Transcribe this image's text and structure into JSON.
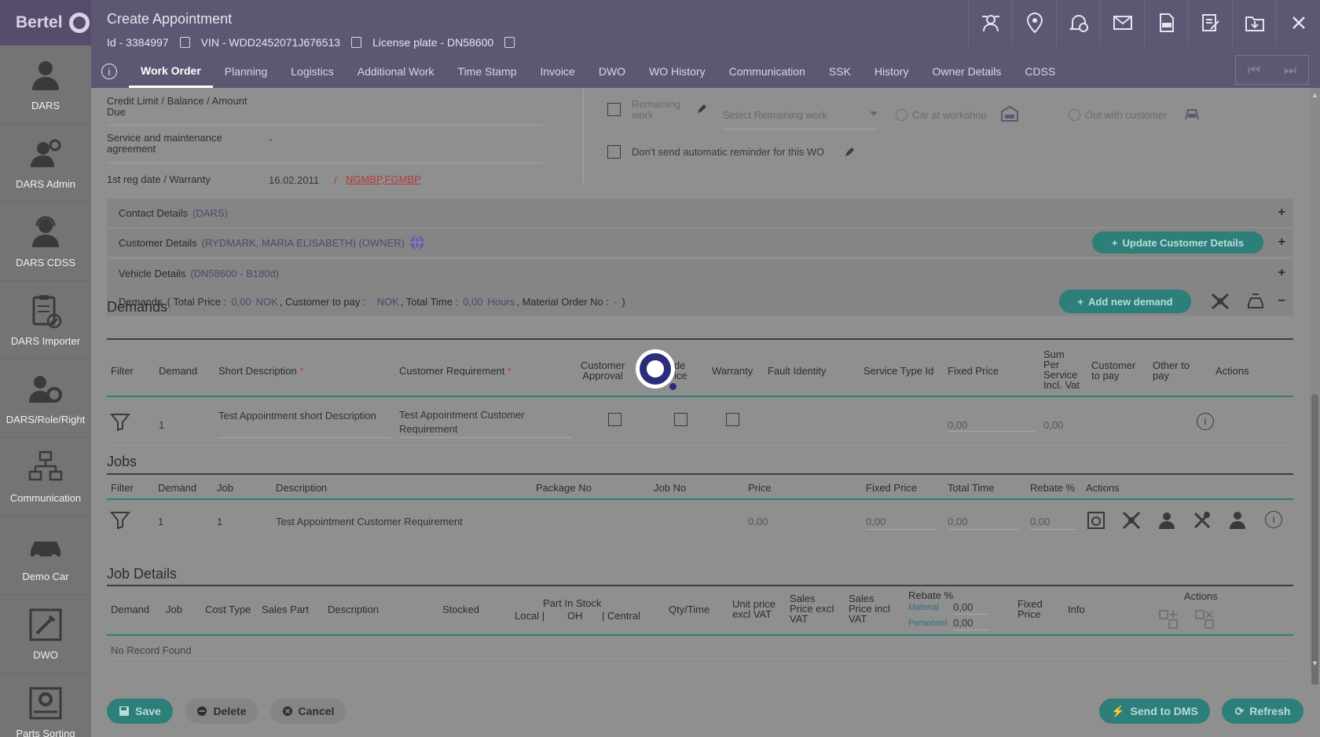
{
  "app": {
    "name": "Bertel"
  },
  "sidebar": {
    "items": [
      {
        "label": "DARS",
        "icon": "user-icon"
      },
      {
        "label": "DARS Admin",
        "icon": "user-gear-icon"
      },
      {
        "label": "DARS CDSS",
        "icon": "headset-user-icon"
      },
      {
        "label": "DARS Importer",
        "icon": "clipboard-check-icon"
      },
      {
        "label": "DARS/Role/Right",
        "icon": "users-gear-icon"
      },
      {
        "label": "Communication",
        "icon": "network-icon"
      },
      {
        "label": "Demo Car",
        "icon": "car-icon"
      },
      {
        "label": "DWO",
        "icon": "tools-icon"
      },
      {
        "label": "Parts Sorting",
        "icon": "settings-box-icon"
      }
    ]
  },
  "header": {
    "title": "Create Appointment",
    "id_text": "Id - 3384997",
    "vin_text": "VIN - WDD2452071J676513",
    "plate_text": "License plate - DN58600",
    "tabs": [
      "Work Order",
      "Planning",
      "Logistics",
      "Additional Work",
      "Time Stamp",
      "Invoice",
      "DWO",
      "WO History",
      "Communication",
      "SSK",
      "History",
      "Owner Details",
      "CDSS"
    ],
    "active_tab": "Work Order",
    "icons": [
      "transfer-user-icon",
      "map-pin-icon",
      "bell-clock-icon",
      "mail-icon",
      "pdf-icon",
      "edit-doc-icon",
      "folder-download-icon",
      "close-icon"
    ]
  },
  "info": {
    "credit_label": "Credit Limit / Balance / Amount Due",
    "service_label": "Service and maintenance agreement",
    "service_value": "-",
    "reg_label": "1st reg date / Warranty",
    "reg_date": "16.02.2011",
    "reg_sep": "/",
    "warranty_link": "NGMBP,FGMBP",
    "remaining_work_label": "Remaining work",
    "remaining_select_placeholder": "Select Remaining work",
    "car_at_workshop": "Car at workshop",
    "out_with_customer": "Out with customer",
    "no_reminder_label": "Don't send automatic reminder for this WO"
  },
  "accordions": {
    "contact": {
      "label": "Contact Details",
      "sub": "(DARS)"
    },
    "customer": {
      "label": "Customer Details",
      "sub": "(RYDMARK, MARIA ELISABETH) (OWNER)",
      "button": "Update Customer Details"
    },
    "vehicle": {
      "label": "Vehicle Details",
      "sub": "(DN58600 - B180d)"
    },
    "demands": {
      "label": "Demands",
      "p1": "( Total Price :",
      "total_price": "0,00",
      "currency": "NOK",
      "p2": ", Customer to pay :",
      "currency2": "NOK",
      "p3": ", Total Time :",
      "total_time": "0,00",
      "hours": "Hours",
      "p4": ", Material Order No :",
      "material_no": "-",
      "p5": ")",
      "button": "Add new demand"
    }
  },
  "demands": {
    "title": "Demands",
    "headers": {
      "filter": "Filter",
      "demand": "Demand",
      "short_desc": "Short Description",
      "cust_req": "Customer Requirement",
      "cust_approval": "Customer Approval",
      "goodwill_frag": "de\nice",
      "warranty": "Warranty",
      "fault": "Fault Identity",
      "service_type": "Service Type Id",
      "fixed_price": "Fixed Price",
      "sum_per_service": "Sum Per Service Incl. Vat",
      "customer_to_pay": "Customer to pay",
      "other_to_pay": "Other to pay",
      "actions": "Actions"
    },
    "required_mark": "*",
    "row": {
      "demand": "1",
      "short_desc": "Test Appointment short Description",
      "cust_req": "Test Appointment Customer Requirement",
      "fixed_price": "0,00",
      "sum": "0,00"
    }
  },
  "jobs": {
    "title": "Jobs",
    "headers": {
      "filter": "Filter",
      "demand": "Demand",
      "job": "Job",
      "description": "Description",
      "package_no": "Package No",
      "job_no": "Job No",
      "price": "Price",
      "fixed_price": "Fixed Price",
      "total_time": "Total Time",
      "rebate": "Rebate %",
      "actions": "Actions"
    },
    "row": {
      "demand": "1",
      "job": "1",
      "description": "Test Appointment Customer Requirement",
      "price": "0,00",
      "fixed_price": "0,00",
      "total_time": "0,00",
      "rebate": "0,00"
    }
  },
  "job_details": {
    "title": "Job Details",
    "headers": {
      "demand": "Demand",
      "job": "Job",
      "cost_type": "Cost Type",
      "sales_part": "Sales Part",
      "description": "Description",
      "stocked": "Stocked",
      "part_in_stock": "Part In Stock",
      "local": "Local |",
      "oh": "OH",
      "central": "| Central",
      "qty_time": "Qty/Time",
      "unit_price": "Unit price excl VAT",
      "sales_excl": "Sales Price excl VAT",
      "sales_incl": "Sales Price incl VAT",
      "rebate": "Rebate %",
      "material": "Material",
      "material_val": "0,00",
      "personnel": "Personnel",
      "personnel_val": "0,00",
      "fixed_price": "Fixed Price",
      "info": "Info",
      "actions": "Actions"
    },
    "empty": "No Record Found"
  },
  "footer": {
    "save": "Save",
    "delete": "Delete",
    "cancel": "Cancel",
    "send_dms": "Send to DMS",
    "refresh": "Refresh"
  },
  "colors": {
    "header": "#5d5773",
    "teal": "#2d7f7a",
    "sidebar": "#747474",
    "overlay_gray": "#8f8f8f"
  }
}
